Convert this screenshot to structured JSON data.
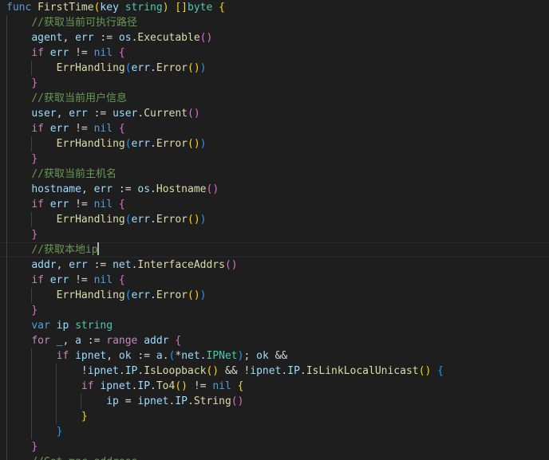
{
  "editor": {
    "language": "go",
    "colors": {
      "background": "#1e1e1e",
      "keyword": "#569cd6",
      "control": "#c586c0",
      "function": "#dcdcaa",
      "variable": "#9cdcfe",
      "type": "#4ec9b0",
      "comment": "#6a9955",
      "bracket1": "#ffd700",
      "bracket2": "#da70d6",
      "bracket3": "#179fff"
    },
    "lines": [
      {
        "indent": 0,
        "tokens": [
          [
            "kw",
            "func"
          ],
          [
            "pn",
            " "
          ],
          [
            "fn",
            "FirstTime"
          ],
          [
            "b1",
            "("
          ],
          [
            "var",
            "key"
          ],
          [
            "pn",
            " "
          ],
          [
            "typ",
            "string"
          ],
          [
            "b1",
            ")"
          ],
          [
            "pn",
            " "
          ],
          [
            "b1",
            "[]"
          ],
          [
            "typ",
            "byte"
          ],
          [
            "pn",
            " "
          ],
          [
            "b1",
            "{"
          ]
        ]
      },
      {
        "indent": 1,
        "tokens": [
          [
            "cmt",
            "//获取当前可执行路径"
          ]
        ]
      },
      {
        "indent": 1,
        "tokens": [
          [
            "var",
            "agent"
          ],
          [
            "pn",
            ", "
          ],
          [
            "var",
            "err"
          ],
          [
            "pn",
            " := "
          ],
          [
            "var",
            "os"
          ],
          [
            "pn",
            "."
          ],
          [
            "fn",
            "Executable"
          ],
          [
            "b2",
            "()"
          ]
        ]
      },
      {
        "indent": 1,
        "tokens": [
          [
            "ctrl",
            "if"
          ],
          [
            "pn",
            " "
          ],
          [
            "var",
            "err"
          ],
          [
            "pn",
            " != "
          ],
          [
            "kw",
            "nil"
          ],
          [
            "pn",
            " "
          ],
          [
            "b2",
            "{"
          ]
        ]
      },
      {
        "indent": 2,
        "tokens": [
          [
            "fn",
            "ErrHandling"
          ],
          [
            "b3",
            "("
          ],
          [
            "var",
            "err"
          ],
          [
            "pn",
            "."
          ],
          [
            "fn",
            "Error"
          ],
          [
            "b1",
            "()"
          ],
          [
            "b3",
            ")"
          ]
        ]
      },
      {
        "indent": 1,
        "tokens": [
          [
            "b2",
            "}"
          ]
        ]
      },
      {
        "indent": 1,
        "tokens": [
          [
            "cmt",
            "//获取当前用户信息"
          ]
        ]
      },
      {
        "indent": 1,
        "tokens": [
          [
            "var",
            "user"
          ],
          [
            "pn",
            ", "
          ],
          [
            "var",
            "err"
          ],
          [
            "pn",
            " := "
          ],
          [
            "var",
            "user"
          ],
          [
            "pn",
            "."
          ],
          [
            "fn",
            "Current"
          ],
          [
            "b2",
            "()"
          ]
        ]
      },
      {
        "indent": 1,
        "tokens": [
          [
            "ctrl",
            "if"
          ],
          [
            "pn",
            " "
          ],
          [
            "var",
            "err"
          ],
          [
            "pn",
            " != "
          ],
          [
            "kw",
            "nil"
          ],
          [
            "pn",
            " "
          ],
          [
            "b2",
            "{"
          ]
        ]
      },
      {
        "indent": 2,
        "tokens": [
          [
            "fn",
            "ErrHandling"
          ],
          [
            "b3",
            "("
          ],
          [
            "var",
            "err"
          ],
          [
            "pn",
            "."
          ],
          [
            "fn",
            "Error"
          ],
          [
            "b1",
            "()"
          ],
          [
            "b3",
            ")"
          ]
        ]
      },
      {
        "indent": 1,
        "tokens": [
          [
            "b2",
            "}"
          ]
        ]
      },
      {
        "indent": 1,
        "tokens": [
          [
            "cmt",
            "//获取当前主机名"
          ]
        ]
      },
      {
        "indent": 1,
        "tokens": [
          [
            "var",
            "hostname"
          ],
          [
            "pn",
            ", "
          ],
          [
            "var",
            "err"
          ],
          [
            "pn",
            " := "
          ],
          [
            "var",
            "os"
          ],
          [
            "pn",
            "."
          ],
          [
            "fn",
            "Hostname"
          ],
          [
            "b2",
            "()"
          ]
        ]
      },
      {
        "indent": 1,
        "tokens": [
          [
            "ctrl",
            "if"
          ],
          [
            "pn",
            " "
          ],
          [
            "var",
            "err"
          ],
          [
            "pn",
            " != "
          ],
          [
            "kw",
            "nil"
          ],
          [
            "pn",
            " "
          ],
          [
            "b2",
            "{"
          ]
        ]
      },
      {
        "indent": 2,
        "tokens": [
          [
            "fn",
            "ErrHandling"
          ],
          [
            "b3",
            "("
          ],
          [
            "var",
            "err"
          ],
          [
            "pn",
            "."
          ],
          [
            "fn",
            "Error"
          ],
          [
            "b1",
            "()"
          ],
          [
            "b3",
            ")"
          ]
        ]
      },
      {
        "indent": 1,
        "tokens": [
          [
            "b2",
            "}"
          ]
        ]
      },
      {
        "indent": 1,
        "current": true,
        "caret": true,
        "tokens": [
          [
            "cmt",
            "//获取本地ip"
          ]
        ]
      },
      {
        "indent": 1,
        "tokens": [
          [
            "var",
            "addr"
          ],
          [
            "pn",
            ", "
          ],
          [
            "var",
            "err"
          ],
          [
            "pn",
            " := "
          ],
          [
            "var",
            "net"
          ],
          [
            "pn",
            "."
          ],
          [
            "fn",
            "InterfaceAddrs"
          ],
          [
            "b2",
            "()"
          ]
        ]
      },
      {
        "indent": 1,
        "tokens": [
          [
            "ctrl",
            "if"
          ],
          [
            "pn",
            " "
          ],
          [
            "var",
            "err"
          ],
          [
            "pn",
            " != "
          ],
          [
            "kw",
            "nil"
          ],
          [
            "pn",
            " "
          ],
          [
            "b2",
            "{"
          ]
        ]
      },
      {
        "indent": 2,
        "tokens": [
          [
            "fn",
            "ErrHandling"
          ],
          [
            "b3",
            "("
          ],
          [
            "var",
            "err"
          ],
          [
            "pn",
            "."
          ],
          [
            "fn",
            "Error"
          ],
          [
            "b1",
            "()"
          ],
          [
            "b3",
            ")"
          ]
        ]
      },
      {
        "indent": 1,
        "tokens": [
          [
            "b2",
            "}"
          ]
        ]
      },
      {
        "indent": 1,
        "tokens": [
          [
            "kw",
            "var"
          ],
          [
            "pn",
            " "
          ],
          [
            "var",
            "ip"
          ],
          [
            "pn",
            " "
          ],
          [
            "typ",
            "string"
          ]
        ]
      },
      {
        "indent": 1,
        "tokens": [
          [
            "ctrl",
            "for"
          ],
          [
            "pn",
            " "
          ],
          [
            "var",
            "_"
          ],
          [
            "pn",
            ", "
          ],
          [
            "var",
            "a"
          ],
          [
            "pn",
            " := "
          ],
          [
            "ctrl",
            "range"
          ],
          [
            "pn",
            " "
          ],
          [
            "var",
            "addr"
          ],
          [
            "pn",
            " "
          ],
          [
            "b2",
            "{"
          ]
        ]
      },
      {
        "indent": 2,
        "tokens": [
          [
            "ctrl",
            "if"
          ],
          [
            "pn",
            " "
          ],
          [
            "var",
            "ipnet"
          ],
          [
            "pn",
            ", "
          ],
          [
            "var",
            "ok"
          ],
          [
            "pn",
            " := "
          ],
          [
            "var",
            "a"
          ],
          [
            "pn",
            "."
          ],
          [
            "b3",
            "("
          ],
          [
            "pn",
            "*"
          ],
          [
            "var",
            "net"
          ],
          [
            "pn",
            "."
          ],
          [
            "typ",
            "IPNet"
          ],
          [
            "b3",
            ")"
          ],
          [
            "pn",
            "; "
          ],
          [
            "var",
            "ok"
          ],
          [
            "pn",
            " &&"
          ]
        ]
      },
      {
        "indent": 3,
        "tokens": [
          [
            "pn",
            "!"
          ],
          [
            "var",
            "ipnet"
          ],
          [
            "pn",
            "."
          ],
          [
            "var",
            "IP"
          ],
          [
            "pn",
            "."
          ],
          [
            "fn",
            "IsLoopback"
          ],
          [
            "b1",
            "()"
          ],
          [
            "pn",
            " && !"
          ],
          [
            "var",
            "ipnet"
          ],
          [
            "pn",
            "."
          ],
          [
            "var",
            "IP"
          ],
          [
            "pn",
            "."
          ],
          [
            "fn",
            "IsLinkLocalUnicast"
          ],
          [
            "b1",
            "()"
          ],
          [
            "pn",
            " "
          ],
          [
            "b3",
            "{"
          ]
        ]
      },
      {
        "indent": 3,
        "tokens": [
          [
            "ctrl",
            "if"
          ],
          [
            "pn",
            " "
          ],
          [
            "var",
            "ipnet"
          ],
          [
            "pn",
            "."
          ],
          [
            "var",
            "IP"
          ],
          [
            "pn",
            "."
          ],
          [
            "fn",
            "To4"
          ],
          [
            "b1",
            "()"
          ],
          [
            "pn",
            " != "
          ],
          [
            "kw",
            "nil"
          ],
          [
            "pn",
            " "
          ],
          [
            "b1",
            "{"
          ]
        ]
      },
      {
        "indent": 4,
        "tokens": [
          [
            "var",
            "ip"
          ],
          [
            "pn",
            " = "
          ],
          [
            "var",
            "ipnet"
          ],
          [
            "pn",
            "."
          ],
          [
            "var",
            "IP"
          ],
          [
            "pn",
            "."
          ],
          [
            "fn",
            "String"
          ],
          [
            "b2",
            "()"
          ]
        ]
      },
      {
        "indent": 3,
        "tokens": [
          [
            "b1",
            "}"
          ]
        ]
      },
      {
        "indent": 2,
        "tokens": [
          [
            "b3",
            "}"
          ]
        ]
      },
      {
        "indent": 1,
        "tokens": [
          [
            "b2",
            "}"
          ]
        ]
      },
      {
        "indent": 1,
        "tokens": [
          [
            "cmt",
            "//Get mac address"
          ]
        ]
      }
    ]
  }
}
